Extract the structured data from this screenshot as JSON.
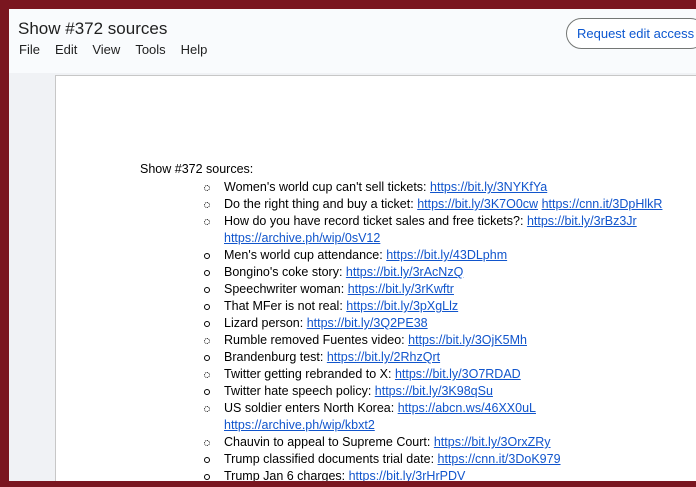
{
  "window": {
    "title": "Show #372 sources"
  },
  "menu": [
    "File",
    "Edit",
    "View",
    "Tools",
    "Help"
  ],
  "request_edit_label": "Request edit access",
  "document": {
    "heading": "Show #372 sources:",
    "items": [
      {
        "text": "Women's world cup can't sell tickets:",
        "links": [
          "https://bit.ly/3NYKfYa"
        ]
      },
      {
        "text": "Do the right thing and buy a ticket:",
        "links": [
          "https://bit.ly/3K7O0cw",
          "https://cnn.it/3DpHlkR"
        ]
      },
      {
        "text": "How do you have record ticket sales and free tickets?:",
        "links": [
          "https://bit.ly/3rBz3Jr"
        ]
      },
      {
        "text": "",
        "links": [
          "https://archive.ph/wip/0sV12"
        ]
      },
      {
        "text": "Men's world cup attendance:",
        "links": [
          "https://bit.ly/43DLphm"
        ]
      },
      {
        "text": "Bongino's coke story:",
        "links": [
          "https://bit.ly/3rAcNzQ"
        ]
      },
      {
        "text": "Speechwriter woman:",
        "links": [
          "https://bit.ly/3rKwftr"
        ]
      },
      {
        "text": "That MFer is not real:",
        "links": [
          "https://bit.ly/3pXgLlz"
        ]
      },
      {
        "text": "Lizard person:",
        "links": [
          "https://bit.ly/3Q2PE38"
        ]
      },
      {
        "text": "Rumble removed Fuentes video:",
        "links": [
          "https://bit.ly/3OjK5Mh"
        ]
      },
      {
        "text": "Brandenburg test:",
        "links": [
          "https://bit.ly/2RhzQrt"
        ]
      },
      {
        "text": "Twitter getting rebranded to X:",
        "links": [
          "https://bit.ly/3O7RDAD"
        ]
      },
      {
        "text": "Twitter hate speech policy:",
        "links": [
          "https://bit.ly/3K98qSu"
        ]
      },
      {
        "text": "US soldier enters North Korea:",
        "links": [
          "https://abcn.ws/46XX0uL"
        ]
      },
      {
        "text": "",
        "links": [
          "https://archive.ph/wip/kbxt2"
        ]
      },
      {
        "text": "Chauvin to appeal to Supreme Court:",
        "links": [
          "https://bit.ly/3OrxZRy"
        ]
      },
      {
        "text": "Trump classified documents trial date:",
        "links": [
          "https://cnn.it/3DoK979"
        ]
      },
      {
        "text": "Trump Jan 6 charges:",
        "links": [
          "https://bit.ly/3rHrPDV"
        ]
      }
    ]
  }
}
